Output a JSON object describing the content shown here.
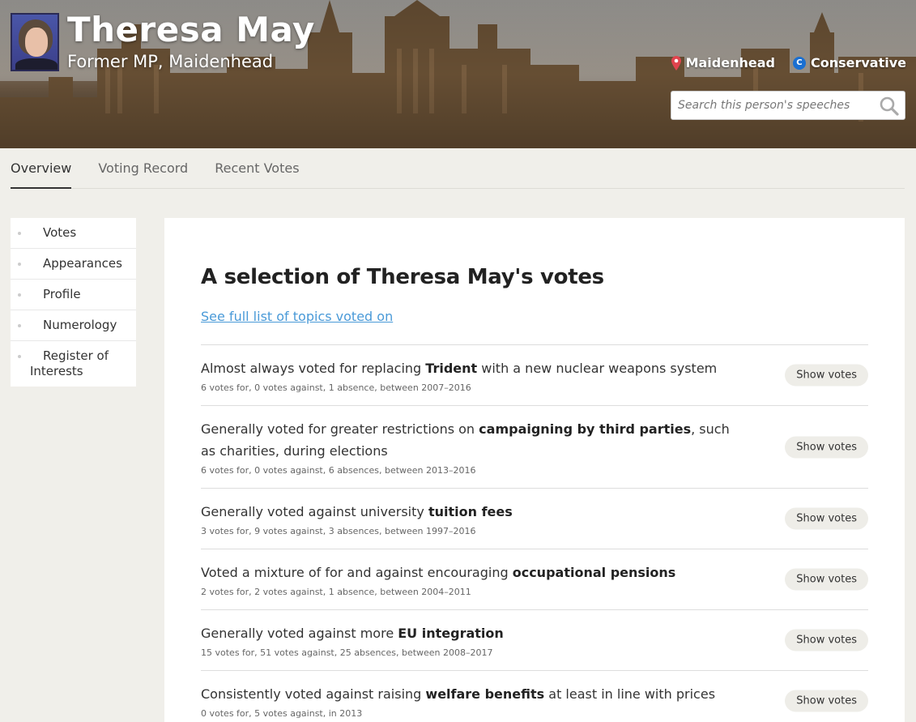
{
  "person": {
    "name": "Theresa May",
    "role": "Former MP, Maidenhead",
    "constituency": "Maidenhead",
    "party": "Conservative",
    "party_badge": "C"
  },
  "search": {
    "placeholder": "Search this person's speeches"
  },
  "tabs": [
    {
      "label": "Overview",
      "active": true
    },
    {
      "label": "Voting Record",
      "active": false
    },
    {
      "label": "Recent Votes",
      "active": false
    }
  ],
  "sidebar": {
    "items": [
      {
        "label": "Votes"
      },
      {
        "label": "Appearances"
      },
      {
        "label": "Profile"
      },
      {
        "label": "Numerology"
      },
      {
        "label": "Register of Interests"
      }
    ]
  },
  "main": {
    "heading": "A selection of Theresa May's votes",
    "topics_link": "See full list of topics voted on",
    "show_votes_label": "Show votes",
    "votes": [
      {
        "pre": "Almost always voted for replacing ",
        "bold": "Trident",
        "post": " with a new nuclear weapons system",
        "detail": "6 votes for, 0 votes against, 1 absence, between 2007–2016"
      },
      {
        "pre": "Generally voted for greater restrictions on ",
        "bold": "campaigning by third parties",
        "post": ", such as charities, during elections",
        "detail": "6 votes for, 0 votes against, 6 absences, between 2013–2016"
      },
      {
        "pre": "Generally voted against university ",
        "bold": "tuition fees",
        "post": "",
        "detail": "3 votes for, 9 votes against, 3 absences, between 1997–2016"
      },
      {
        "pre": "Voted a mixture of for and against encouraging ",
        "bold": "occupational pensions",
        "post": "",
        "detail": "2 votes for, 2 votes against, 1 absence, between 2004–2011"
      },
      {
        "pre": "Generally voted against more ",
        "bold": "EU integration",
        "post": "",
        "detail": "15 votes for, 51 votes against, 25 absences, between 2008–2017"
      },
      {
        "pre": "Consistently voted against raising ",
        "bold": "welfare benefits",
        "post": " at least in line with prices",
        "detail": "0 votes for, 5 votes against, in 2013"
      }
    ]
  },
  "colors": {
    "accent_link": "#4a9ad8",
    "pin": "#e0444e",
    "party": "#1a6fd1",
    "page_bg": "#f0efea"
  }
}
